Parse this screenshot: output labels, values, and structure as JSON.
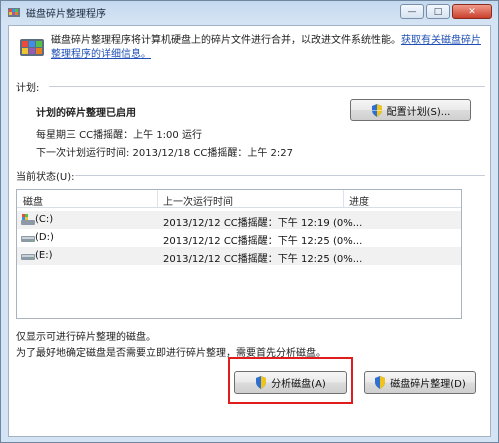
{
  "window": {
    "title": "磁盘碎片整理程序",
    "minimize_label": "—",
    "maximize_label": "□",
    "close_label": "✕"
  },
  "intro": {
    "description": "磁盘碎片整理程序将计算机硬盘上的碎片文件进行合并，以改进文件系统性能。",
    "link": "获取有关磁盘碎片整理程序的详细信息。"
  },
  "schedule": {
    "section_label": "计划:",
    "status": "计划的碎片整理已启用",
    "run_line": "每星期三  CC播摇醒：上午 1:00 运行",
    "next_line": "下一次计划运行时间: 2013/12/18 CC播摇醒：上午 2:27",
    "configure_button": "配置计划(S)..."
  },
  "current_status": {
    "section_label": "当前状态(U):",
    "columns": [
      "磁盘",
      "上一次运行时间",
      "进度"
    ],
    "rows": [
      {
        "drive": "(C:)",
        "last_run": "2013/12/12 CC播摇醒：下午 12:19 (0%...",
        "progress": "",
        "icon": "system-drive-icon"
      },
      {
        "drive": "(D:)",
        "last_run": "2013/12/12 CC播摇醒：下午 12:25 (0%...",
        "progress": "",
        "icon": "hard-drive-icon"
      },
      {
        "drive": "(E:)",
        "last_run": "2013/12/12 CC播摇醒：下午 12:25 (0%...",
        "progress": "",
        "icon": "hard-drive-icon"
      }
    ]
  },
  "footer": {
    "note1": "仅显示可进行碎片整理的磁盘。",
    "note2": "为了最好地确定磁盘是否需要立即进行碎片整理，需要首先分析磁盘。",
    "analyze_button": "分析磁盘(A)",
    "defrag_button": "磁盘碎片整理(D)"
  },
  "colors": {
    "highlight": "#e11c1c",
    "link": "#1f4fb4",
    "chrome": "#c9dcef"
  }
}
